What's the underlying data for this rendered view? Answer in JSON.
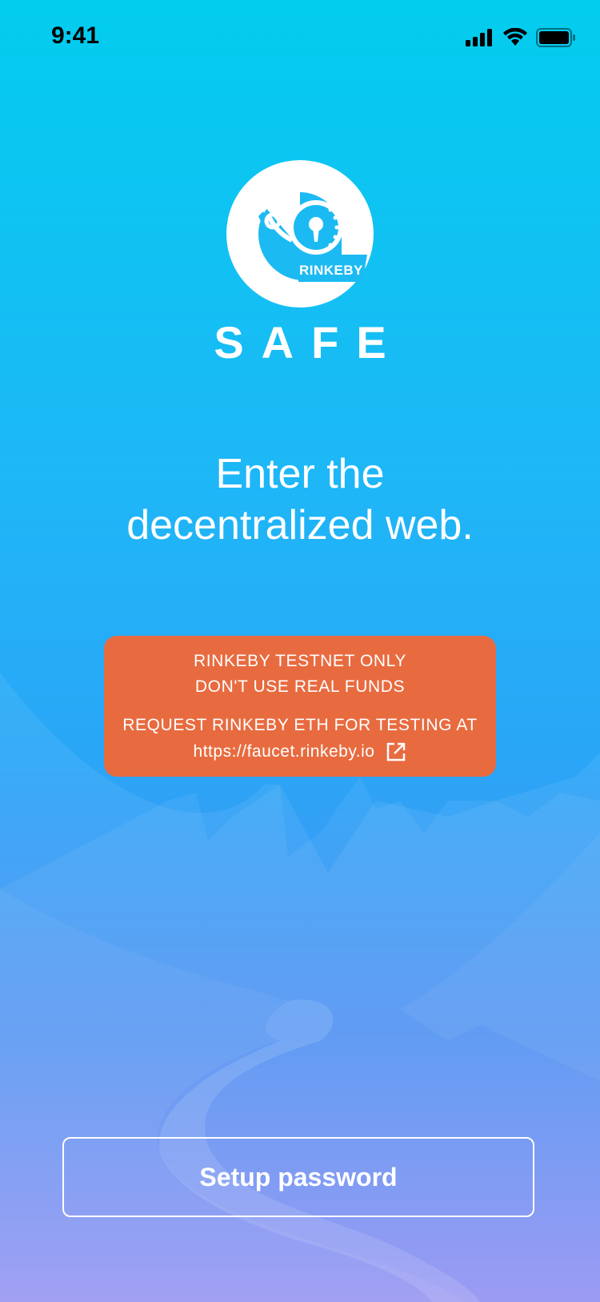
{
  "status_bar": {
    "time": "9:41",
    "icons": [
      "cellular-signal-icon",
      "wifi-icon",
      "battery-icon"
    ]
  },
  "logo": {
    "badge_text": "RINKEBY",
    "wordmark": "SAFE"
  },
  "headline": {
    "line1": "Enter the",
    "line2": "decentralized web."
  },
  "warning": {
    "line1": "RINKEBY TESTNET ONLY",
    "line2": "DON'T USE REAL FUNDS",
    "line3": "REQUEST RINKEBY ETH FOR TESTING AT",
    "link": "https://faucet.rinkeby.io",
    "link_icon": "external-link-icon",
    "color": "#e86b40"
  },
  "actions": {
    "setup_password": "Setup password"
  },
  "colors": {
    "gradient_top": "#02cdee",
    "gradient_bottom": "#8f8df3"
  }
}
